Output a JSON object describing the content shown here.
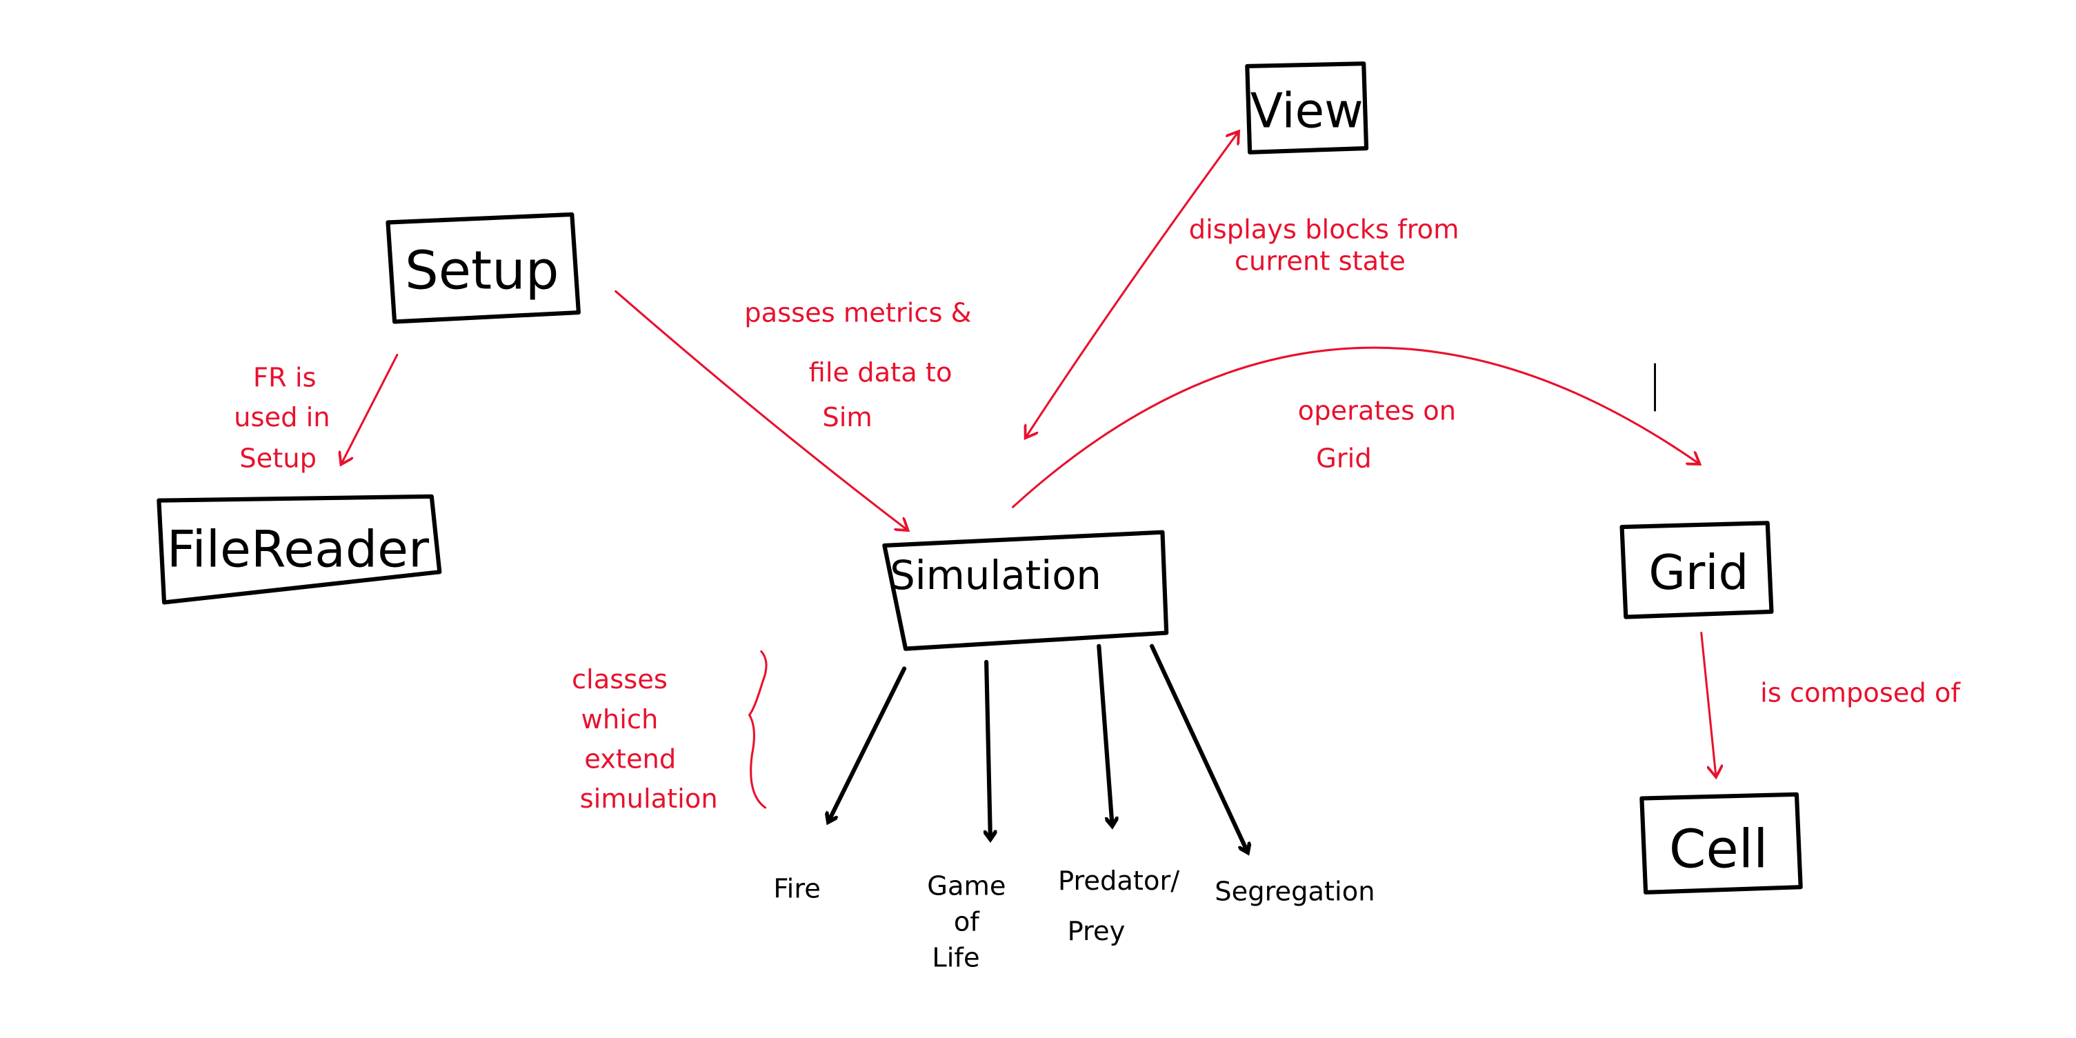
{
  "nodes": {
    "view": "View",
    "setup": "Setup",
    "filereader": "FileReader",
    "simulation": "Simulation",
    "grid": "Grid",
    "cell": "Cell"
  },
  "subclasses": {
    "fire": "Fire",
    "game_of_life": [
      "Game",
      "of",
      "Life"
    ],
    "predator_prey": [
      "Predator/",
      "Prey"
    ],
    "segregation": "Segregation"
  },
  "annotations": {
    "fr_used": [
      "FR is",
      "used in",
      "Setup"
    ],
    "passes": [
      "passes metrics &",
      "file data to",
      "Sim"
    ],
    "displays": [
      "displays blocks from",
      "current state"
    ],
    "operates": [
      "operates on",
      "Grid"
    ],
    "composed": "is composed of",
    "classes": [
      "classes",
      "which",
      "extend",
      "simulation"
    ]
  },
  "colors": {
    "ink": "#000000",
    "annotation": "#e8112d"
  }
}
